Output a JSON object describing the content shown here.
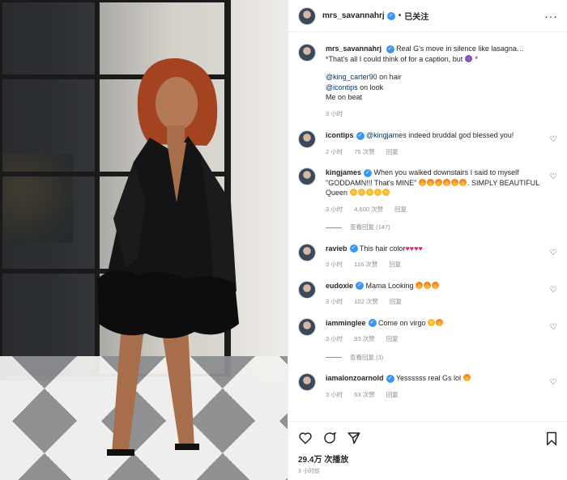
{
  "post": {
    "username": "mrs_savannahrj",
    "follow_status": "已关注",
    "caption_lines": [
      "Real G's move in silence like lasagna…*That's all I could think of for a caption, but ",
      "*"
    ],
    "credits": [
      {
        "handle": "@king_carter90",
        "text": " on hair"
      },
      {
        "handle": "@icontips",
        "text": " on look"
      },
      {
        "handle": "",
        "text": "Me on beat"
      }
    ],
    "time": "3 小时"
  },
  "comments": [
    {
      "username": "icontips",
      "verified": true,
      "text_parts": [
        {
          "tag": "@kingjames"
        },
        {
          "text": " indeed bruddal god blessed you!"
        }
      ],
      "time": "2 小时",
      "likes": "75 次赞",
      "reply": "回复",
      "view_replies": ""
    },
    {
      "username": "kingjames",
      "verified": true,
      "text_parts": [
        {
          "text": "When you walked downstairs I said to myself \"GODDAMN!!! That's MINE\" "
        },
        {
          "emoji": "fire",
          "count": 6
        },
        {
          "text": ". SIMPLY BEAUTIFUL Queen "
        },
        {
          "emoji": "sun",
          "count": 5
        }
      ],
      "time": "3 小时",
      "likes": "4,600 次赞",
      "reply": "回复",
      "view_replies": "查看回复 (147)"
    },
    {
      "username": "ravieb",
      "verified": true,
      "text_parts": [
        {
          "text": "This hair color"
        },
        {
          "hearts": "♥♥♥♥"
        }
      ],
      "time": "3 小时",
      "likes": "116 次赞",
      "reply": "回复",
      "view_replies": ""
    },
    {
      "username": "eudoxie",
      "verified": true,
      "text_parts": [
        {
          "text": "Mama Looking "
        },
        {
          "emoji": "fire",
          "count": 3
        }
      ],
      "time": "3 小时",
      "likes": "102 次赞",
      "reply": "回复",
      "view_replies": ""
    },
    {
      "username": "iamminglee",
      "verified": true,
      "text_parts": [
        {
          "text": "Come on virgo "
        },
        {
          "emoji": "sun",
          "count": 1
        },
        {
          "emoji": "fire",
          "count": 1
        }
      ],
      "time": "3 小时",
      "likes": "93 次赞",
      "reply": "回复",
      "view_replies": "查看回复 (3)"
    },
    {
      "username": "iamalonzoarnold",
      "verified": true,
      "text_parts": [
        {
          "text": "Yessssss real Gs lol "
        },
        {
          "emoji": "fire",
          "count": 1
        }
      ],
      "time": "3 小时",
      "likes": "63 次赞",
      "reply": "回复",
      "view_replies": ""
    }
  ],
  "footer": {
    "views": "29.4万 次播放",
    "time": "3 小时前"
  },
  "colors": {
    "verified": "#3897f0",
    "link": "#00376b",
    "muted": "#8e8e8e"
  },
  "icons": [
    "heart-icon",
    "comment-icon",
    "share-icon",
    "bookmark-icon",
    "more-icon"
  ]
}
